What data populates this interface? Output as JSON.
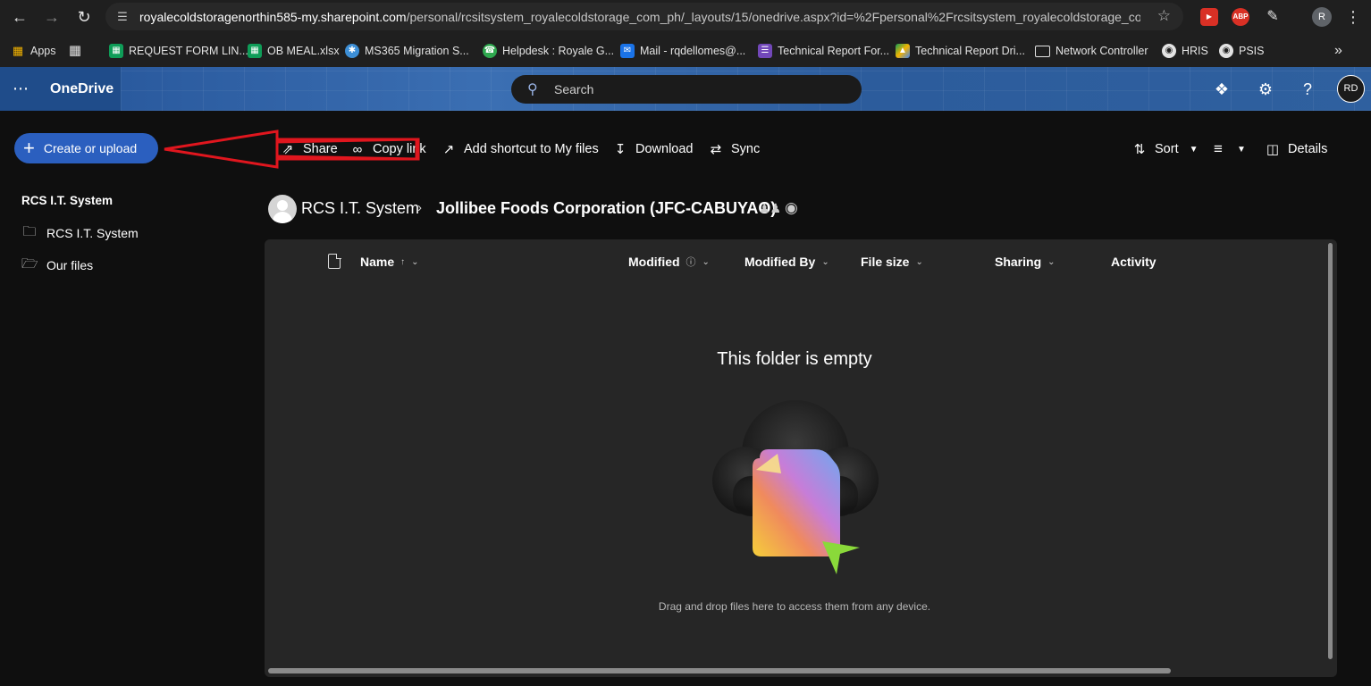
{
  "browser": {
    "url_host": "royalecoldstoragenorthin585-my.sharepoint.com",
    "url_path": "/personal/rcsitsystem_royalecoldstorage_com_ph/_layouts/15/onedrive.aspx?id=%2Fpersonal%2Frcsitsystem_royalecoldstorage_co...",
    "extensions": [
      "ABP"
    ],
    "profile_initial": "R",
    "bookmarks": [
      {
        "label": "Apps",
        "icon": "apps-grid-icon"
      },
      {
        "label": "REQUEST FORM LIN...",
        "icon": "sheets-icon"
      },
      {
        "label": "OB MEAL.xlsx",
        "icon": "sheets-icon"
      },
      {
        "label": "MS365 Migration S...",
        "icon": "migration-icon"
      },
      {
        "label": "Helpdesk : Royale G...",
        "icon": "headset-icon"
      },
      {
        "label": "Mail - rqdellomes@...",
        "icon": "mail-icon"
      },
      {
        "label": "Technical Report For...",
        "icon": "forms-icon"
      },
      {
        "label": "Technical Report Dri...",
        "icon": "drive-icon"
      },
      {
        "label": "Network Controller",
        "icon": "folder-icon"
      },
      {
        "label": "HRIS",
        "icon": "globe-icon"
      },
      {
        "label": "PSIS",
        "icon": "globe-icon"
      }
    ]
  },
  "header": {
    "app_title": "OneDrive",
    "search_placeholder": "Search",
    "user_initials": "RD"
  },
  "command_bar": {
    "create_label": "Create or upload",
    "share_label": "Share",
    "copy_link_label": "Copy link",
    "add_shortcut_label": "Add shortcut to My files",
    "download_label": "Download",
    "sync_label": "Sync",
    "sort_label": "Sort",
    "details_label": "Details"
  },
  "sidebar": {
    "title": "RCS I.T. System",
    "items": [
      {
        "label": "RCS I.T. System"
      },
      {
        "label": "Our files"
      }
    ]
  },
  "breadcrumb": {
    "root": "RCS I.T. System",
    "current": "Jollibee Foods Corporation (JFC-CABUYAO)"
  },
  "columns": {
    "name": "Name",
    "modified": "Modified",
    "modified_by": "Modified By",
    "file_size": "File size",
    "sharing": "Sharing",
    "activity": "Activity"
  },
  "empty_state": {
    "title": "This folder is empty",
    "subtitle": "Drag and drop files here to access them from any device."
  },
  "colors": {
    "accent": "#2b5fbf",
    "annotation": "#e0161e"
  }
}
